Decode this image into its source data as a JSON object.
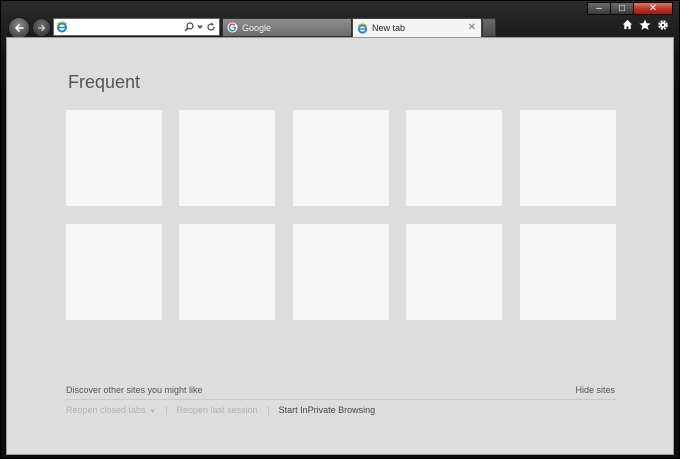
{
  "window": {
    "controls": {
      "minimize_label": "–",
      "maximize_label": "□",
      "close_label": "✕"
    }
  },
  "toolbar": {
    "address": {
      "value": "",
      "placeholder": ""
    },
    "icons": [
      "back-arrow-icon",
      "forward-arrow-icon",
      "ie-logo-icon",
      "search-icon",
      "dropdown-icon",
      "refresh-icon",
      "home-icon",
      "favorites-star-icon",
      "settings-gear-icon"
    ]
  },
  "tabs": [
    {
      "label": "Google",
      "icon": "google-g-icon",
      "active": false
    },
    {
      "label": "New tab",
      "icon": "ie-logo-icon",
      "active": true,
      "close_label": "✕"
    }
  ],
  "newtab": {
    "title": "Frequent",
    "tile_count": 10,
    "discover_label": "Discover other sites you might like",
    "hide_sites_label": "Hide sites",
    "links": {
      "reopen_closed_tabs": "Reopen closed tabs",
      "reopen_last_session": "Reopen last session",
      "inprivate": "Start InPrivate Browsing"
    }
  },
  "colors": {
    "content_bg": "#dddddd",
    "tile_bg": "#f6f6f6",
    "close_button": "#c0392b"
  }
}
